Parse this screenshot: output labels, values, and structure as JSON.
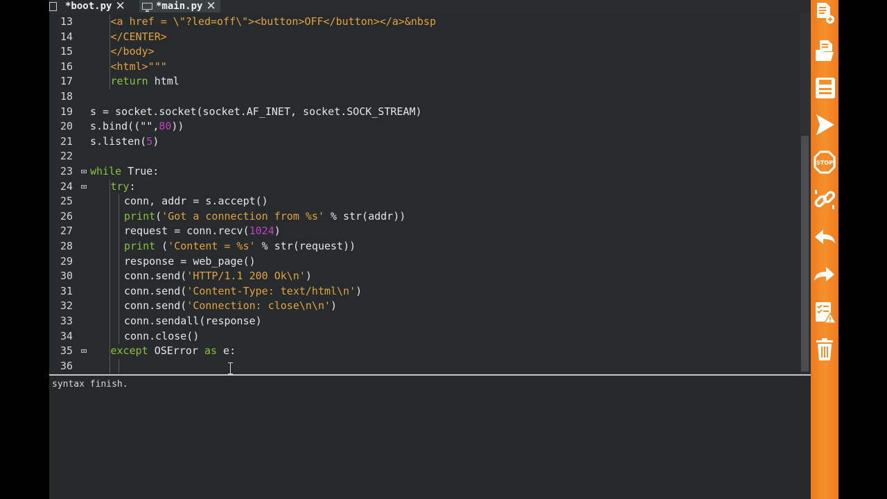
{
  "tabs": [
    {
      "label": "*boot.py",
      "active": false
    },
    {
      "label": "*main.py",
      "active": true
    }
  ],
  "tab_close_glyph": "✕",
  "editor": {
    "lines": [
      {
        "n": "13",
        "fold": "",
        "indent": 2,
        "tokens": [
          {
            "t": "<a href = \\\"?led=off\\\"><button>OFF</button></a>&nbsp",
            "c": "str"
          }
        ]
      },
      {
        "n": "14",
        "fold": "",
        "indent": 2,
        "tokens": [
          {
            "t": "</CENTER>",
            "c": "str"
          }
        ]
      },
      {
        "n": "15",
        "fold": "",
        "indent": 2,
        "tokens": [
          {
            "t": "</body>",
            "c": "str"
          }
        ]
      },
      {
        "n": "16",
        "fold": "",
        "indent": 2,
        "tokens": [
          {
            "t": "<html>\"\"\"",
            "c": "str"
          }
        ]
      },
      {
        "n": "17",
        "fold": "",
        "indent": 2,
        "tokens": [
          {
            "t": "return",
            "c": "kw"
          },
          {
            "t": " html",
            "c": "plain"
          }
        ]
      },
      {
        "n": "18",
        "fold": "",
        "indent": 0,
        "tokens": []
      },
      {
        "n": "19",
        "fold": "",
        "indent": 0,
        "tokens": [
          {
            "t": "s = socket.socket(socket.AF_INET, socket.SOCK_STREAM)",
            "c": "plain"
          }
        ]
      },
      {
        "n": "20",
        "fold": "",
        "indent": 0,
        "tokens": [
          {
            "t": "s.bind((",
            "c": "plain"
          },
          {
            "t": "\"\"",
            "c": "plain"
          },
          {
            "t": ",",
            "c": "plain"
          },
          {
            "t": "80",
            "c": "num"
          },
          {
            "t": "))",
            "c": "plain"
          }
        ]
      },
      {
        "n": "21",
        "fold": "",
        "indent": 0,
        "tokens": [
          {
            "t": "s.listen(",
            "c": "plain"
          },
          {
            "t": "5",
            "c": "num"
          },
          {
            "t": ")",
            "c": "plain"
          }
        ]
      },
      {
        "n": "22",
        "fold": "",
        "indent": 0,
        "tokens": []
      },
      {
        "n": "23",
        "fold": "minus",
        "indent": 0,
        "tokens": [
          {
            "t": "while",
            "c": "kw"
          },
          {
            "t": " True:",
            "c": "plain"
          }
        ]
      },
      {
        "n": "24",
        "fold": "minus",
        "indent": 2,
        "tokens": [
          {
            "t": "try",
            "c": "kw"
          },
          {
            "t": ":",
            "c": "plain"
          }
        ]
      },
      {
        "n": "25",
        "fold": "",
        "indent": 3,
        "tokens": [
          {
            "t": "conn, addr = s.accept()",
            "c": "plain"
          }
        ]
      },
      {
        "n": "26",
        "fold": "",
        "indent": 3,
        "tokens": [
          {
            "t": "print",
            "c": "kw"
          },
          {
            "t": "(",
            "c": "plain"
          },
          {
            "t": "'Got a connection from %s'",
            "c": "str"
          },
          {
            "t": " % str(addr))",
            "c": "plain"
          }
        ]
      },
      {
        "n": "27",
        "fold": "",
        "indent": 3,
        "tokens": [
          {
            "t": "request = conn.recv(",
            "c": "plain"
          },
          {
            "t": "1024",
            "c": "num"
          },
          {
            "t": ")",
            "c": "plain"
          }
        ]
      },
      {
        "n": "28",
        "fold": "",
        "indent": 3,
        "tokens": [
          {
            "t": "print",
            "c": "kw"
          },
          {
            "t": " (",
            "c": "plain"
          },
          {
            "t": "'Content = %s'",
            "c": "str"
          },
          {
            "t": " % str(request))",
            "c": "plain"
          }
        ]
      },
      {
        "n": "29",
        "fold": "",
        "indent": 3,
        "tokens": [
          {
            "t": "response = web_page()",
            "c": "plain"
          }
        ]
      },
      {
        "n": "30",
        "fold": "",
        "indent": 3,
        "tokens": [
          {
            "t": "conn.send(",
            "c": "plain"
          },
          {
            "t": "'HTTP/1.1 200 Ok\\n'",
            "c": "str"
          },
          {
            "t": ")",
            "c": "plain"
          }
        ]
      },
      {
        "n": "31",
        "fold": "",
        "indent": 3,
        "tokens": [
          {
            "t": "conn.send(",
            "c": "plain"
          },
          {
            "t": "'Content-Type: text/html\\n'",
            "c": "str"
          },
          {
            "t": ")",
            "c": "plain"
          }
        ]
      },
      {
        "n": "32",
        "fold": "",
        "indent": 3,
        "tokens": [
          {
            "t": "conn.send(",
            "c": "plain"
          },
          {
            "t": "'Connection: close\\n\\n'",
            "c": "str"
          },
          {
            "t": ")",
            "c": "plain"
          }
        ]
      },
      {
        "n": "33",
        "fold": "",
        "indent": 3,
        "tokens": [
          {
            "t": "conn.sendall(response)",
            "c": "plain"
          }
        ]
      },
      {
        "n": "34",
        "fold": "",
        "indent": 3,
        "tokens": [
          {
            "t": "conn.close()",
            "c": "plain"
          }
        ]
      },
      {
        "n": "35",
        "fold": "minus",
        "indent": 2,
        "tokens": [
          {
            "t": "except",
            "c": "kw"
          },
          {
            "t": " OSError ",
            "c": "plain"
          },
          {
            "t": "as",
            "c": "kw"
          },
          {
            "t": " e:",
            "c": "plain"
          }
        ]
      },
      {
        "n": "36",
        "fold": "",
        "indent": 3,
        "tokens": []
      }
    ]
  },
  "output": {
    "text": "syntax finish."
  },
  "toolbar": {
    "tools": [
      {
        "icon": "new-file-icon"
      },
      {
        "icon": "open-folder-icon"
      },
      {
        "icon": "save-icon"
      },
      {
        "icon": "run-icon"
      },
      {
        "icon": "stop-icon",
        "label": "STOP"
      },
      {
        "icon": "disconnect-icon"
      },
      {
        "icon": "undo-icon"
      },
      {
        "icon": "redo-icon"
      },
      {
        "icon": "syntax-check-icon"
      },
      {
        "icon": "clear-icon"
      }
    ]
  },
  "colors": {
    "editor_bg": "#272b2e",
    "string": "#e2a33b",
    "keyword": "#8ec23a",
    "number": "#c440c4",
    "toolbar": "#f4902a"
  }
}
